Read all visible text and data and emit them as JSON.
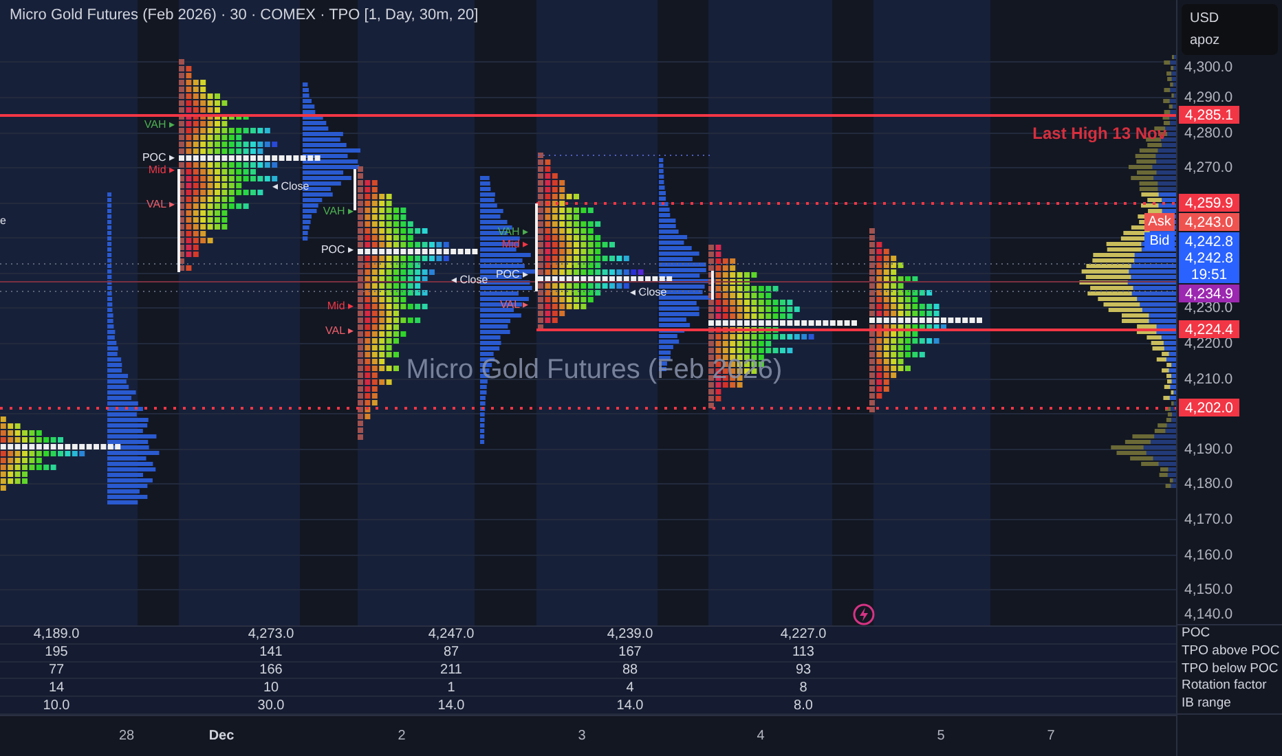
{
  "legend": {
    "title": "Micro Gold Futures (Feb 2026) · 30 · COMEX · TPO [1, Day, 30m, 20]"
  },
  "account_box": {
    "currency": "USD",
    "user": "apoz"
  },
  "watermark_subtitle": "Micro Gold Futures (Feb 2026)",
  "level_label": "Last High 13 Nov",
  "profiles": [
    {
      "labels": [
        {
          "kind": "close",
          "text": "e"
        }
      ]
    },
    {
      "labels": [
        {
          "kind": "vah",
          "text": "VAH ▸"
        },
        {
          "kind": "poc",
          "text": "POC ▸"
        },
        {
          "kind": "mid",
          "text": "Mid ▸"
        },
        {
          "kind": "val",
          "text": "VAL ▸"
        },
        {
          "kind": "close",
          "text": "◂ Close"
        }
      ]
    },
    {
      "labels": [
        {
          "kind": "vah",
          "text": "VAH ▸"
        },
        {
          "kind": "poc",
          "text": "POC ▸"
        },
        {
          "kind": "mid",
          "text": "Mid ▸"
        },
        {
          "kind": "val",
          "text": "VAL ▸"
        },
        {
          "kind": "close",
          "text": "◂ Close"
        }
      ]
    },
    {
      "labels": [
        {
          "kind": "vah",
          "text": "VAH ▸"
        },
        {
          "kind": "mid",
          "text": "Mid ▸"
        },
        {
          "kind": "poc",
          "text": "POC ▸"
        },
        {
          "kind": "val",
          "text": "VAL ▸"
        },
        {
          "kind": "close",
          "text": "◂ Close"
        }
      ]
    }
  ],
  "price_axis": {
    "ticks": [
      "4,300.0",
      "4,290.0",
      "4,280.0",
      "4,270.0",
      "4,230.0",
      "4,220.0",
      "4,210.0",
      "4,190.0",
      "4,180.0",
      "4,170.0",
      "4,160.0",
      "4,150.0",
      "4,140.0"
    ],
    "tags": [
      {
        "price": "4,285.1",
        "color": "#f23645"
      },
      {
        "price": "4,259.9",
        "color": "#f23645"
      },
      {
        "price": "4,243.0",
        "color": "#ef5350",
        "side_label": "Ask"
      },
      {
        "price": "4,242.8",
        "color": "#2962ff",
        "side_label": "Bid"
      },
      {
        "price": "4,242.8",
        "sub": "19:51",
        "color": "#2962ff"
      },
      {
        "price": "4,234.9",
        "color": "#9c27b0"
      },
      {
        "price": "4,224.4",
        "color": "#f23645"
      },
      {
        "price": "4,202.0",
        "color": "#f23645"
      }
    ]
  },
  "stats": {
    "rows": [
      {
        "label": "POC",
        "values": [
          "4,189.0",
          "4,273.0",
          "4,247.0",
          "4,239.0",
          "4,227.0"
        ]
      },
      {
        "label": "TPO above POC",
        "values": [
          "195",
          "141",
          "87",
          "167",
          "113"
        ]
      },
      {
        "label": "TPO below POC",
        "values": [
          "77",
          "166",
          "211",
          "88",
          "93"
        ]
      },
      {
        "label": "Rotation factor",
        "values": [
          "14",
          "10",
          "1",
          "4",
          "8"
        ]
      },
      {
        "label": "IB range",
        "values": [
          "10.0",
          "30.0",
          "14.0",
          "14.0",
          "8.0"
        ]
      }
    ]
  },
  "time_axis": {
    "labels": [
      {
        "text": "28",
        "bold": false
      },
      {
        "text": "Dec",
        "bold": true
      },
      {
        "text": "2",
        "bold": false
      },
      {
        "text": "3",
        "bold": false
      },
      {
        "text": "4",
        "bold": false
      },
      {
        "text": "5",
        "bold": false
      },
      {
        "text": "7",
        "bold": false
      }
    ]
  }
}
